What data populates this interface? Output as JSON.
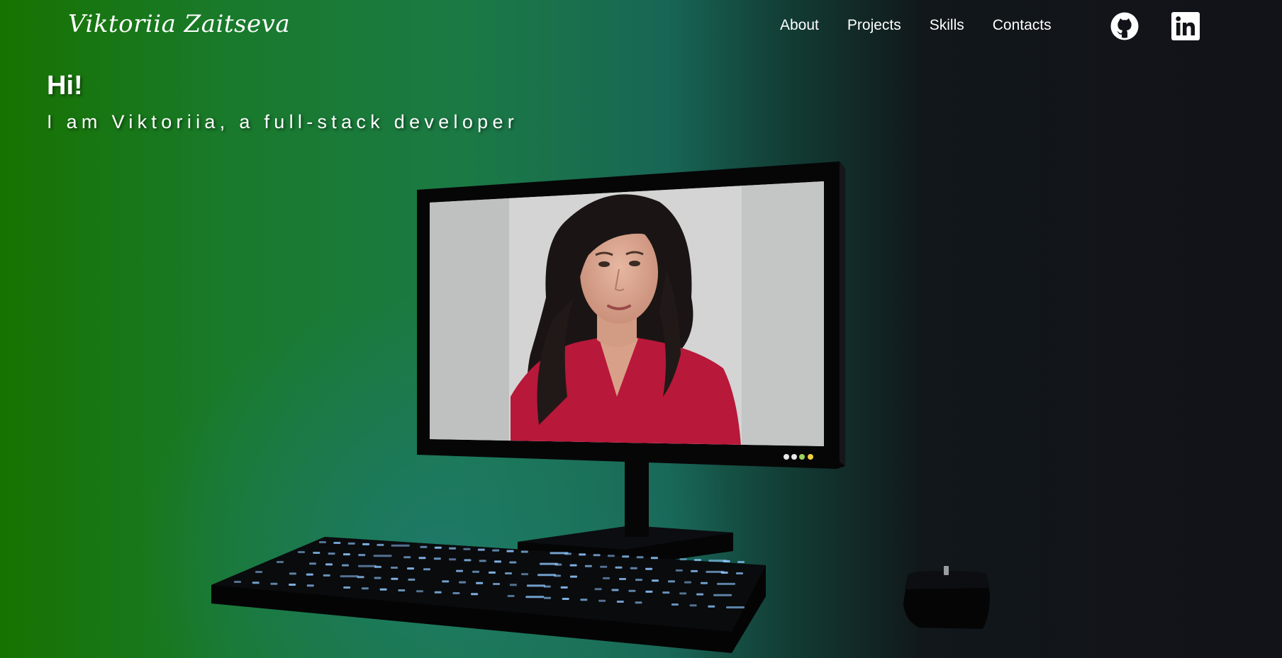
{
  "header": {
    "logo": "Viktoriia Zaitseva",
    "nav": [
      "About",
      "Projects",
      "Skills",
      "Contacts"
    ],
    "social": [
      {
        "icon": "github-icon"
      },
      {
        "icon": "linkedin-icon"
      }
    ]
  },
  "hero": {
    "title": "Hi!",
    "subtitle": "I am Viktoriia, a full-stack developer"
  },
  "scene": {
    "objects": [
      "monitor",
      "keyboard",
      "mouse"
    ],
    "screen_content": "portrait-photo",
    "screen_indicator_colors": [
      "#e8e8e8",
      "#e8e8e8",
      "#9bd25a",
      "#f0d03a"
    ],
    "key_glow_color": "#8ec7ff"
  },
  "colors": {
    "gradient_left": "#177300",
    "gradient_mid": "#1b7a44",
    "gradient_teal": "#1e786e",
    "gradient_right": "#121219",
    "text": "#ffffff"
  }
}
